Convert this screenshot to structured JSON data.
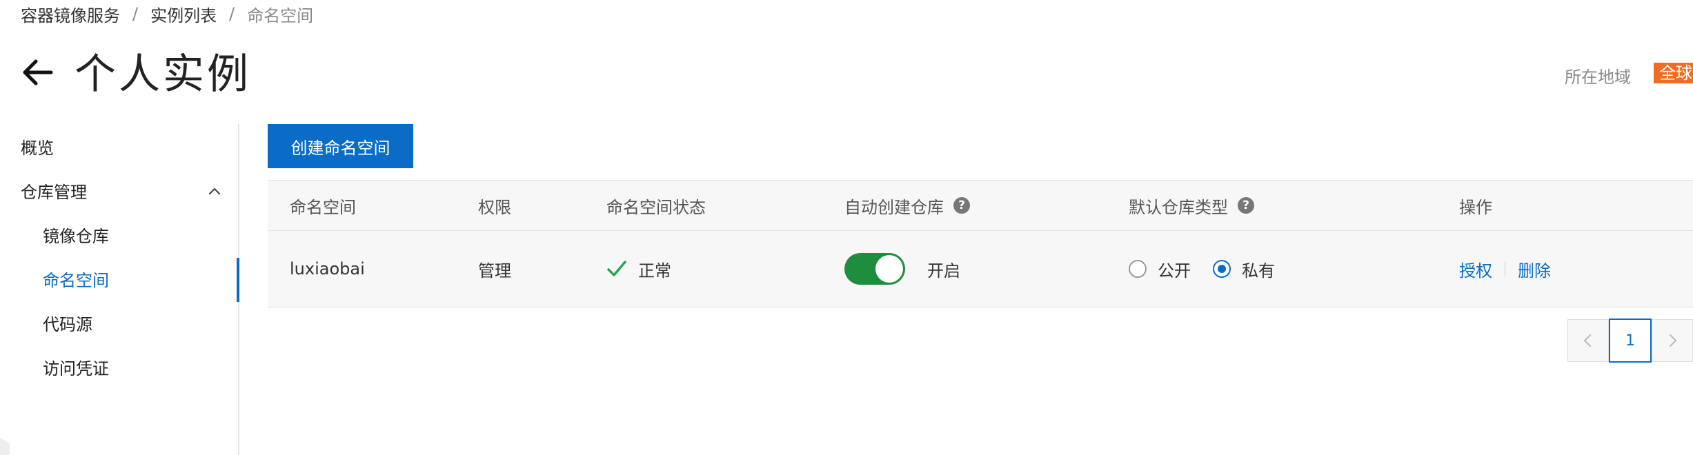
{
  "breadcrumb": [
    "容器镜像服务",
    "实例列表",
    "命名空间"
  ],
  "breadcrumb_sep": "/",
  "page": {
    "title": "个人实例",
    "region_label": "所在地域",
    "region_value": "全球"
  },
  "sidebar": {
    "items": [
      {
        "label": "概览",
        "level": 1
      },
      {
        "label": "仓库管理",
        "level": 1,
        "expanded": true
      },
      {
        "label": "镜像仓库",
        "level": 2
      },
      {
        "label": "命名空间",
        "level": 2,
        "active": true
      },
      {
        "label": "代码源",
        "level": 2
      },
      {
        "label": "访问凭证",
        "level": 2
      }
    ]
  },
  "toolbar": {
    "create_label": "创建命名空间"
  },
  "table": {
    "columns": [
      "命名空间",
      "权限",
      "命名空间状态",
      "自动创建仓库",
      "默认仓库类型",
      "操作"
    ],
    "help_glyph": "?",
    "rows": [
      {
        "namespace": "luxiaobai",
        "permission": "管理",
        "status": "正常",
        "auto_create": "开启",
        "repo_type_options": [
          "公开",
          "私有"
        ],
        "repo_type_selected": "私有",
        "actions": [
          "授权",
          "删除"
        ]
      }
    ]
  },
  "pagination": {
    "current": "1"
  },
  "colors": {
    "primary": "#0a6cc7",
    "toggle_on": "#1e8e3e",
    "badge": "#f26d21",
    "success": "#2ea44f"
  },
  "icons": {
    "back": "arrow-left-icon",
    "chevron": "chevron-up-icon",
    "status": "check-icon",
    "help": "help-circle-icon",
    "prev": "chevron-left-icon",
    "next": "chevron-right-icon"
  }
}
